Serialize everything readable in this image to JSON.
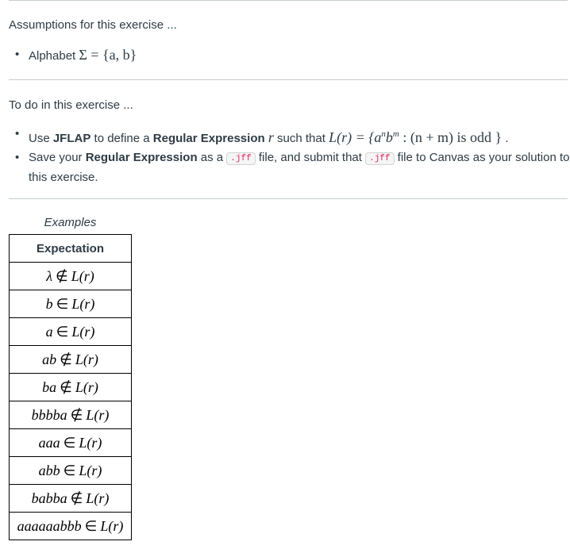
{
  "assumptions": {
    "heading": "Assumptions for this exercise ...",
    "items": [
      {
        "label": "Alphabet",
        "math": "Σ = {a, b}"
      }
    ]
  },
  "todo": {
    "heading": "To do in this exercise ...",
    "item1": {
      "t1": "Use ",
      "b1": "JFLAP",
      "t2": " to define a ",
      "b2": "Regular Expression",
      "t3": " such that ",
      "math_lhs": "L(r) = {",
      "math_a": "a",
      "math_n": "n",
      "math_b": "b",
      "math_m": "m",
      "math_rest": " : (n + m) is odd }",
      "t4": " ."
    },
    "item2": {
      "t1": "Save your ",
      "b1": "Regular Expression",
      "t2": " as a ",
      "code1": ".jff",
      "t3": " file, and submit that ",
      "code2": ".jff",
      "t4": " file to Canvas as your solution to this exercise."
    }
  },
  "examples": {
    "caption": "Examples",
    "header": "Expectation",
    "rows": [
      {
        "string": "λ",
        "relation": "∉",
        "language": "L(r)"
      },
      {
        "string": "b",
        "relation": "∈",
        "language": "L(r)"
      },
      {
        "string": "a",
        "relation": "∈",
        "language": "L(r)"
      },
      {
        "string": "ab",
        "relation": "∉",
        "language": "L(r)"
      },
      {
        "string": "ba",
        "relation": "∉",
        "language": "L(r)"
      },
      {
        "string": "bbbba",
        "relation": "∉",
        "language": "L(r)"
      },
      {
        "string": "aaa",
        "relation": "∈",
        "language": "L(r)"
      },
      {
        "string": "abb",
        "relation": "∈",
        "language": "L(r)"
      },
      {
        "string": "babba",
        "relation": "∉",
        "language": "L(r)"
      },
      {
        "string": "aaaaaabbb",
        "relation": "∈",
        "language": "L(r)"
      }
    ]
  },
  "colors": {
    "text": "#2d3b45",
    "rule": "#c7cdd1",
    "code_text": "#e0245e",
    "code_bg": "#f5f5f5"
  }
}
